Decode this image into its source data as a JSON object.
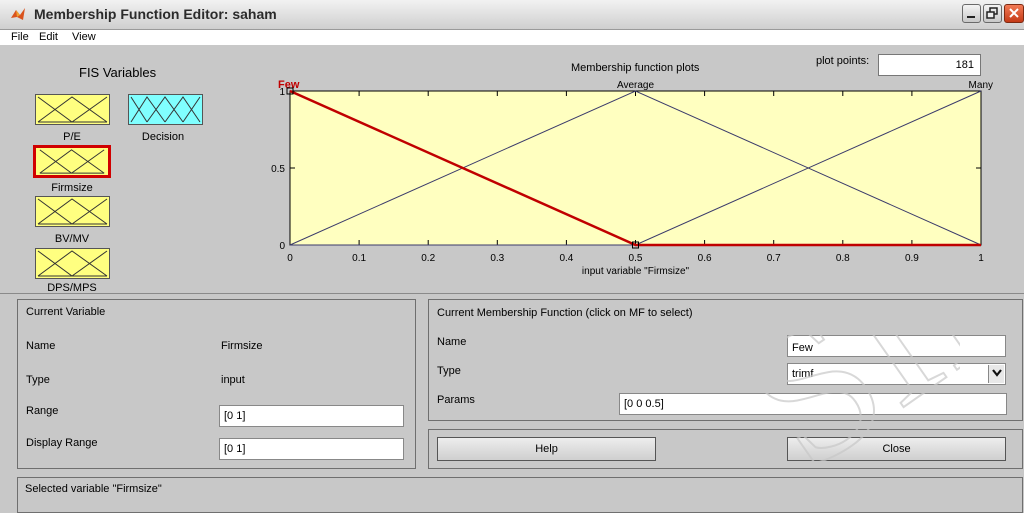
{
  "window": {
    "title": "Membership Function Editor: saham"
  },
  "menu": [
    "File",
    "Edit",
    "View"
  ],
  "fis": {
    "title": "FIS Variables",
    "inputs": [
      "P/E",
      "Firmsize",
      "BV/MV",
      "DPS/MPS"
    ],
    "output": "Decision",
    "selected": "Firmsize"
  },
  "plot": {
    "title": "Membership function plots",
    "plot_points_label": "plot points:",
    "plot_points": "181"
  },
  "chart_data": {
    "type": "line",
    "xlabel": "input variable \"Firmsize\"",
    "xlim": [
      0,
      1
    ],
    "ylim": [
      0,
      1
    ],
    "x_ticks": [
      "0",
      "0.1",
      "0.2",
      "0.3",
      "0.4",
      "0.5",
      "0.6",
      "0.7",
      "0.8",
      "0.9",
      "1"
    ],
    "y_ticks": [
      "0",
      "0.5",
      "1"
    ],
    "series": [
      {
        "name": "Few",
        "x": [
          0,
          0.5,
          1
        ],
        "y": [
          1,
          0,
          0
        ],
        "selected": true,
        "color": "#c00000"
      },
      {
        "name": "Average",
        "x": [
          0,
          0.5,
          1
        ],
        "y": [
          0,
          1,
          0
        ],
        "selected": false,
        "color": "#3a3a6a"
      },
      {
        "name": "Many",
        "x": [
          0,
          0.5,
          1
        ],
        "y": [
          0,
          0,
          1
        ],
        "selected": false,
        "color": "#3a3a6a"
      }
    ]
  },
  "current_variable": {
    "title": "Current Variable",
    "name_label": "Name",
    "name": "Firmsize",
    "type_label": "Type",
    "type": "input",
    "range_label": "Range",
    "range": "[0 1]",
    "display_range_label": "Display Range",
    "display_range": "[0 1]"
  },
  "current_mf": {
    "title": "Current Membership Function (click on MF to select)",
    "name_label": "Name",
    "name": "Few",
    "type_label": "Type",
    "type": "trimf",
    "params_label": "Params",
    "params": "[0 0 0.5]"
  },
  "buttons": {
    "help": "Help",
    "close": "Close"
  },
  "status": "Selected variable \"Firmsize\"",
  "watermark": "SID",
  "colors": {
    "background": "#c8c8c8",
    "input_var": "#ffff80",
    "output_var": "#80ffff",
    "plot_bg": "#ffffc0",
    "selected": "#c00000"
  }
}
